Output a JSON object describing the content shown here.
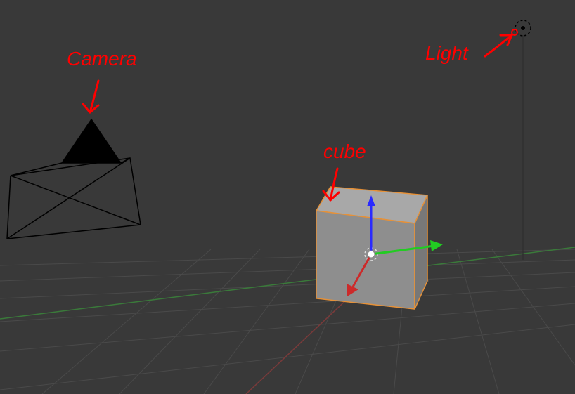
{
  "annotations": {
    "camera_label": "Camera",
    "cube_label": "cube",
    "light_label": "Light"
  },
  "objects": {
    "camera": "Camera",
    "cube": "Cube",
    "light": "Point Light"
  },
  "gizmo": {
    "x_axis_color": "#cc3333",
    "y_axis_color": "#33cc33",
    "z_axis_color": "#3333ff"
  },
  "colors": {
    "background": "#393939",
    "grid": "#4a4a4a",
    "x_axis_grid": "#7a3a3a",
    "y_axis_grid": "#3a6a3a",
    "selection": "#e69138",
    "annotation": "#ff0000"
  }
}
